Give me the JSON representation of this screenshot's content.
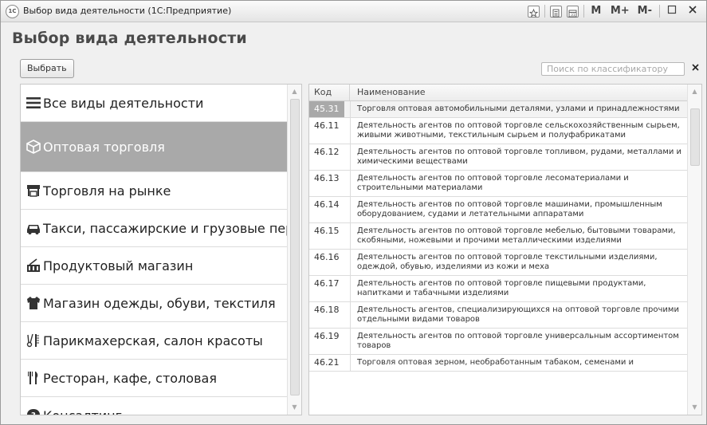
{
  "window": {
    "title": "Выбор вида деятельности (1С:Предприятие)",
    "logo_text": "1С",
    "toolbar": [
      "M",
      "M+",
      "M-"
    ]
  },
  "page": {
    "title": "Выбор вида деятельности",
    "select_button": "Выбрать",
    "search_placeholder": "Поиск по классификатору",
    "search_value": ""
  },
  "left": {
    "items": [
      {
        "label": "Все виды деятельности",
        "icon": "list-icon",
        "selected": false
      },
      {
        "label": "Оптовая торговля",
        "icon": "box-icon",
        "selected": true
      },
      {
        "label": "Торговля на рынке",
        "icon": "market-stall-icon",
        "selected": false
      },
      {
        "label": "Такси, пассажирские и грузовые перевс",
        "icon": "car-icon",
        "selected": false
      },
      {
        "label": "Продуктовый магазин",
        "icon": "shop-basket-icon",
        "selected": false
      },
      {
        "label": "Магазин одежды, обуви, текстиля",
        "icon": "clothes-icon",
        "selected": false
      },
      {
        "label": "Парикмахерская, салон красоты",
        "icon": "scissors-comb-icon",
        "selected": false
      },
      {
        "label": "Ресторан, кафе, столовая",
        "icon": "fork-knife-icon",
        "selected": false
      },
      {
        "label": "Консалтинг",
        "icon": "question-bubble-icon",
        "selected": false
      }
    ]
  },
  "table": {
    "headers": {
      "code": "Код",
      "name": "Наименование"
    },
    "rows": [
      {
        "code": "45.31",
        "name": "Торговля оптовая автомобильными деталями, узлами и принадлежностями",
        "selected": true
      },
      {
        "code": "46.11",
        "name": "Деятельность агентов по оптовой торговле сельскохозяйственным сырьем, живыми животными, текстильным сырьем и полуфабрикатами",
        "selected": false
      },
      {
        "code": "46.12",
        "name": "Деятельность агентов по оптовой торговле топливом, рудами, металлами и химическими веществами",
        "selected": false
      },
      {
        "code": "46.13",
        "name": "Деятельность агентов по оптовой торговле лесоматериалами и строительными материалами",
        "selected": false
      },
      {
        "code": "46.14",
        "name": "Деятельность агентов по оптовой торговле машинами, промышленным оборудованием, судами и летательными аппаратами",
        "selected": false
      },
      {
        "code": "46.15",
        "name": "Деятельность агентов по оптовой торговле мебелью, бытовыми товарами, скобяными, ножевыми и прочими металлическими изделиями",
        "selected": false
      },
      {
        "code": "46.16",
        "name": "Деятельность агентов по оптовой торговле текстильными изделиями, одеждой, обувью, изделиями из кожи и меха",
        "selected": false
      },
      {
        "code": "46.17",
        "name": "Деятельность агентов по оптовой торговле пищевыми продуктами, напитками и табачными изделиями",
        "selected": false
      },
      {
        "code": "46.18",
        "name": "Деятельность агентов, специализирующихся на оптовой торговле прочими отдельными видами товаров",
        "selected": false
      },
      {
        "code": "46.19",
        "name": "Деятельность агентов по оптовой торговле универсальным ассортиментом товаров",
        "selected": false
      },
      {
        "code": "46.21",
        "name": "Торговля оптовая зерном, необработанным табаком, семенами и",
        "selected": false
      }
    ]
  }
}
